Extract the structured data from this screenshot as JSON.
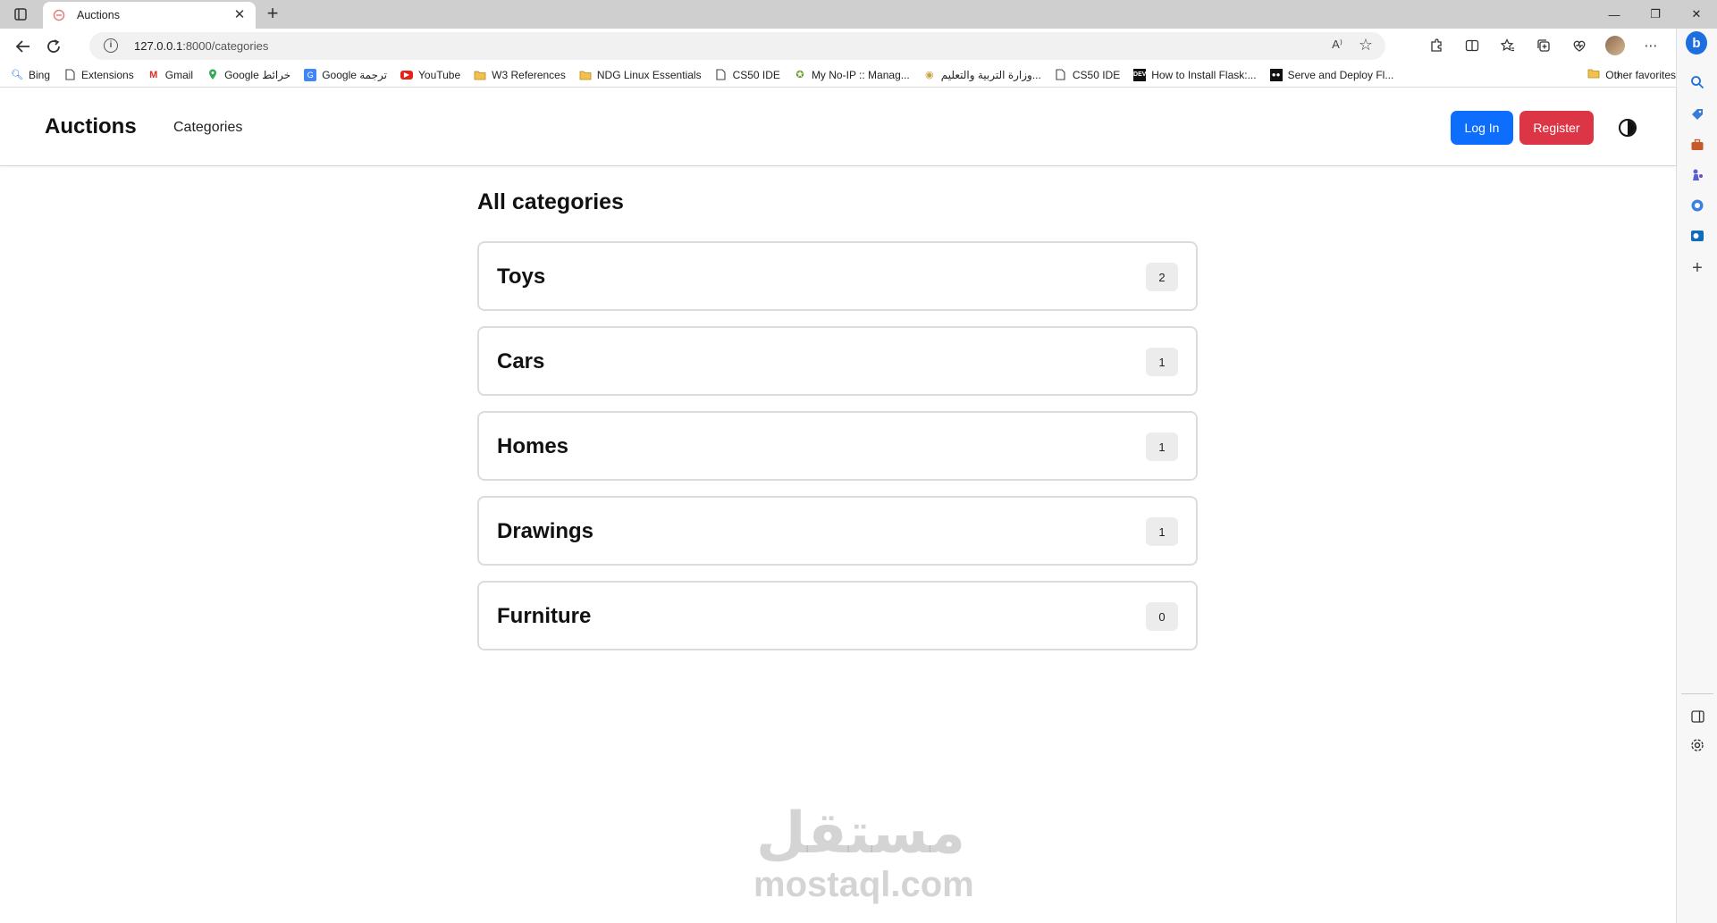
{
  "browser": {
    "tab_title": "Auctions",
    "tab_close": "✕",
    "new_tab": "+",
    "url_host": "127.0.0.1",
    "url_path": ":8000/categories",
    "read_aloud": "A⁾",
    "window_controls": [
      "—",
      "❐",
      "✕"
    ]
  },
  "favorites": [
    {
      "label": "Bing",
      "icon": "search-icon"
    },
    {
      "label": "Extensions",
      "icon": "page-icon"
    },
    {
      "label": "Gmail",
      "icon": "gmail-icon"
    },
    {
      "label": "Google خرائط",
      "icon": "maps-pin-icon"
    },
    {
      "label": "Google ترجمة",
      "icon": "translate-icon"
    },
    {
      "label": "YouTube",
      "icon": "youtube-icon"
    },
    {
      "label": "W3 References",
      "icon": "folder-icon"
    },
    {
      "label": "NDG Linux Essentials",
      "icon": "folder-icon"
    },
    {
      "label": "CS50 IDE",
      "icon": "page-icon"
    },
    {
      "label": "My No-IP :: Manag...",
      "icon": "noip-icon"
    },
    {
      "label": "وزارة التربية والتعليم...",
      "icon": "ministry-icon"
    },
    {
      "label": "CS50 IDE",
      "icon": "page-icon"
    },
    {
      "label": "How to Install Flask:...",
      "icon": "dev-icon"
    },
    {
      "label": "Serve and Deploy Fl...",
      "icon": "medium-icon"
    }
  ],
  "favorites_other": "Other favorites",
  "site": {
    "brand": "Auctions",
    "nav_categories": "Categories",
    "login": "Log In",
    "register": "Register"
  },
  "page": {
    "title": "All categories",
    "categories": [
      {
        "name": "Toys",
        "count": "2"
      },
      {
        "name": "Cars",
        "count": "1"
      },
      {
        "name": "Homes",
        "count": "1"
      },
      {
        "name": "Drawings",
        "count": "1"
      },
      {
        "name": "Furniture",
        "count": "0"
      }
    ]
  },
  "watermark": {
    "arabic": "مستقل",
    "latin": "mostaql.com"
  },
  "colors": {
    "login_bg": "#0d6efd",
    "register_bg": "#dc3545",
    "badge_bg": "#ececec"
  }
}
